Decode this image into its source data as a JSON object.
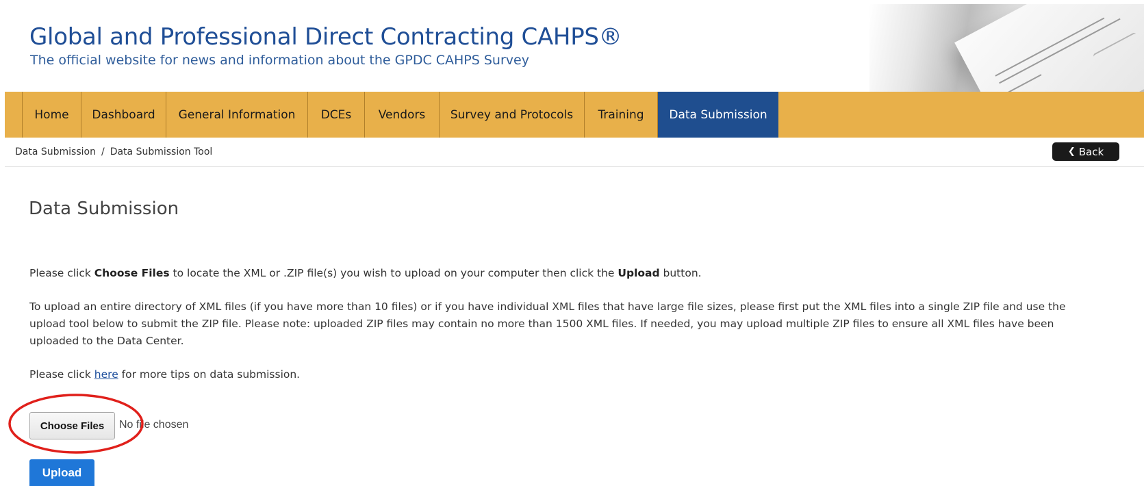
{
  "header": {
    "title": "Global and Professional Direct Contracting CAHPS®",
    "tagline": "The official website for news and information about the GPDC CAHPS Survey"
  },
  "nav": {
    "items": [
      {
        "label": "Home"
      },
      {
        "label": "Dashboard"
      },
      {
        "label": "General Information"
      },
      {
        "label": "DCEs"
      },
      {
        "label": "Vendors"
      },
      {
        "label": "Survey and Protocols"
      },
      {
        "label": "Training"
      },
      {
        "label": "Data Submission",
        "active": true
      }
    ]
  },
  "breadcrumb": {
    "items": [
      "Data Submission",
      "Data Submission Tool"
    ],
    "separator": "/"
  },
  "back_button": {
    "label": "Back",
    "icon": "chevron-left-icon"
  },
  "page": {
    "title": "Data Submission",
    "p1": {
      "t1": "Please click ",
      "b1": "Choose Files",
      "t2": " to locate the XML or .ZIP file(s) you wish to upload on your computer then click the ",
      "b2": "Upload",
      "t3": " button."
    },
    "p2": "To upload an entire directory of XML files (if you have more than 10 files) or if you have individual XML files that have large file sizes, please first put the XML files into a single ZIP file and use the upload tool below to submit the ZIP file. Please note: uploaded ZIP files may contain no more than 1500 XML files. If needed, you may upload multiple ZIP files to ensure all XML files have been uploaded to the Data Center.",
    "p3": {
      "t1": "Please click ",
      "link": "here",
      "t2": " for more tips on data submission."
    }
  },
  "file_input": {
    "button_label": "Choose Files",
    "status": "No file chosen"
  },
  "upload_button": {
    "label": "Upload"
  },
  "colors": {
    "nav_bg": "#e8b04a",
    "nav_active": "#1f4e8f",
    "title_blue": "#1f4e96",
    "upload_blue": "#1f77d8",
    "annotation_red": "#e0201b"
  }
}
